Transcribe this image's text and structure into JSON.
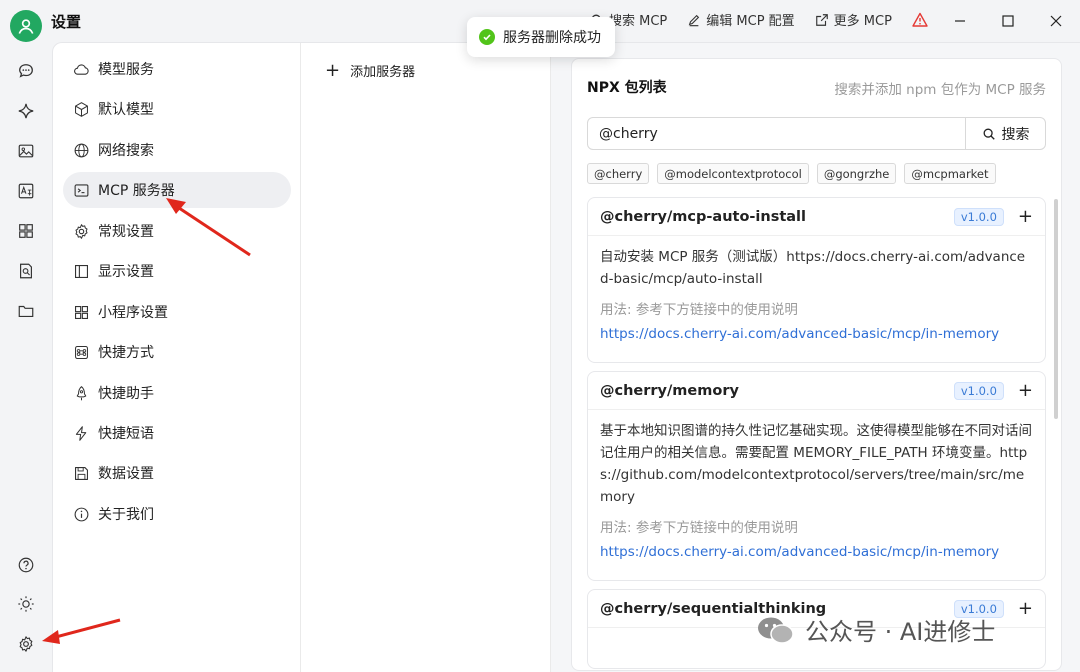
{
  "app": {
    "title": "设置"
  },
  "top_actions": [
    {
      "label": "搜索 MCP",
      "icon": "search-icon"
    },
    {
      "label": "编辑 MCP 配置",
      "icon": "edit-icon"
    },
    {
      "label": "更多 MCP",
      "icon": "external-link-icon"
    }
  ],
  "toast": {
    "text": "服务器删除成功"
  },
  "settings_menu": [
    {
      "label": "模型服务",
      "icon": "cloud-icon"
    },
    {
      "label": "默认模型",
      "icon": "cube-icon"
    },
    {
      "label": "网络搜索",
      "icon": "globe-icon"
    },
    {
      "label": "MCP 服务器",
      "icon": "terminal-icon",
      "active": true
    },
    {
      "label": "常规设置",
      "icon": "gear-icon"
    },
    {
      "label": "显示设置",
      "icon": "layout-icon"
    },
    {
      "label": "小程序设置",
      "icon": "grid-icon"
    },
    {
      "label": "快捷方式",
      "icon": "command-icon"
    },
    {
      "label": "快捷助手",
      "icon": "rocket-icon"
    },
    {
      "label": "快捷短语",
      "icon": "zap-icon"
    },
    {
      "label": "数据设置",
      "icon": "save-icon"
    },
    {
      "label": "关于我们",
      "icon": "info-icon"
    }
  ],
  "server_col": {
    "add_label": "添加服务器"
  },
  "npx": {
    "title": "NPX 包列表",
    "subtitle": "搜索并添加 npm 包作为 MCP 服务",
    "search_value": "@cherry",
    "search_button": "搜索",
    "tags": [
      "@cherry",
      "@modelcontextprotocol",
      "@gongrzhe",
      "@mcpmarket"
    ],
    "packages": [
      {
        "name": "@cherry/mcp-auto-install",
        "version": "v1.0.0",
        "description": "自动安装 MCP 服务（测试版）https://docs.cherry-ai.com/advanced-basic/mcp/auto-install",
        "usage": "用法: 参考下方链接中的使用说明",
        "link": "https://docs.cherry-ai.com/advanced-basic/mcp/in-memory"
      },
      {
        "name": "@cherry/memory",
        "version": "v1.0.0",
        "description": "基于本地知识图谱的持久性记忆基础实现。这使得模型能够在不同对话间记住用户的相关信息。需要配置 MEMORY_FILE_PATH 环境变量。https://github.com/modelcontextprotocol/servers/tree/main/src/memory",
        "usage": "用法: 参考下方链接中的使用说明",
        "link": "https://docs.cherry-ai.com/advanced-basic/mcp/in-memory"
      },
      {
        "name": "@cherry/sequentialthinking",
        "version": "v1.0.0",
        "description": "",
        "usage": "",
        "link": ""
      }
    ]
  },
  "watermark": {
    "text": "公众号 · AI进修士"
  },
  "colors": {
    "accent_green": "#22a861",
    "link_blue": "#2f6fd6",
    "warn_red": "#e53935",
    "success": "#52c41a"
  }
}
